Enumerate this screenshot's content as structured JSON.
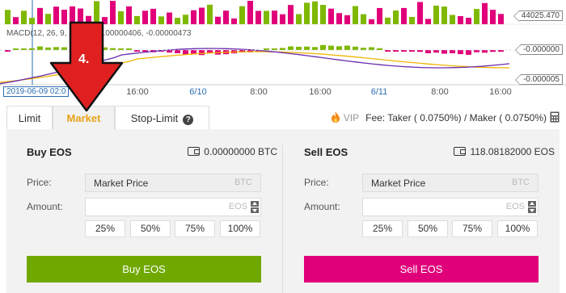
{
  "chart": {
    "macd_label": "MACD(12, 26, 9, ... 067, -0.00000406, -0.00000473",
    "price_tag_top": "44025.470",
    "price_tag_mid": "-0.000000",
    "price_tag_low": "-0.000005",
    "cursor_date": "2019-06-09 02:0",
    "ticks": [
      {
        "label": "16:00",
        "blue": false
      },
      {
        "label": "6/10",
        "blue": true
      },
      {
        "label": "8:00",
        "blue": false
      },
      {
        "label": "16:00",
        "blue": false
      },
      {
        "label": "6/11",
        "blue": true
      },
      {
        "label": "8:00",
        "blue": false
      },
      {
        "label": "16:00",
        "blue": false
      }
    ],
    "colors": {
      "up": "#7fb800",
      "down": "#e0007a",
      "macd": "#6a2bb0",
      "signal": "#f0b400"
    }
  },
  "annotation": {
    "step": "4."
  },
  "tabs": {
    "limit": "Limit",
    "market": "Market",
    "stop_limit": "Stop-Limit",
    "help": "?"
  },
  "fee": {
    "vip": "VIP",
    "text": "Fee: Taker ( 0.0750%) / Maker ( 0.0750%)"
  },
  "buy": {
    "title": "Buy EOS",
    "balance": "0.00000000 BTC",
    "price_label": "Price:",
    "price_value": "Market Price",
    "price_unit": "BTC",
    "amount_label": "Amount:",
    "amount_placeholder": "",
    "amount_unit": "EOS",
    "pcts": [
      "25%",
      "50%",
      "75%",
      "100%"
    ],
    "button": "Buy EOS"
  },
  "sell": {
    "title": "Sell EOS",
    "balance": "118.08182000 EOS",
    "price_label": "Price:",
    "price_value": "Market Price",
    "price_unit": "BTC",
    "amount_label": "Amount:",
    "amount_placeholder": "",
    "amount_unit": "EOS",
    "pcts": [
      "25%",
      "50%",
      "75%",
      "100%"
    ],
    "button": "Sell EOS"
  }
}
